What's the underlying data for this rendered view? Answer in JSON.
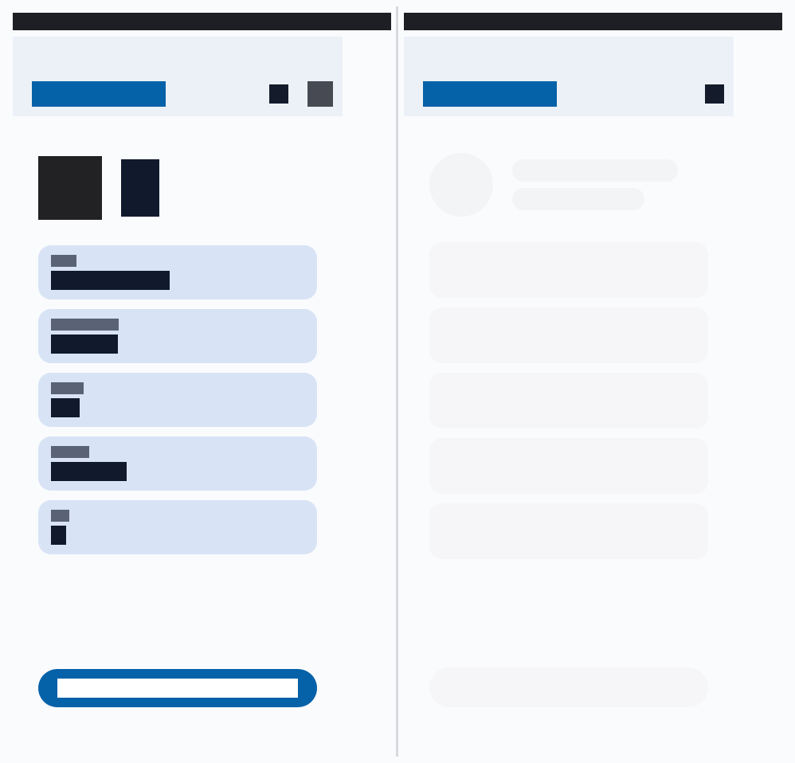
{
  "colors": {
    "background": "#fafbfd",
    "titlebar": "#1e1f25",
    "header": "#ecf1f8",
    "accent": "#0561a8",
    "card": "#d8e3f5",
    "label_block": "#5a6376",
    "value_block": "#111a2c",
    "skeleton": "#f3f4f6",
    "divider": "#d7d9de"
  },
  "left_panel": {
    "fields_count": 5,
    "has_avatar": true,
    "has_primary_button": true
  },
  "right_panel": {
    "state": "loading-skeleton",
    "skeleton_cards": 5
  }
}
